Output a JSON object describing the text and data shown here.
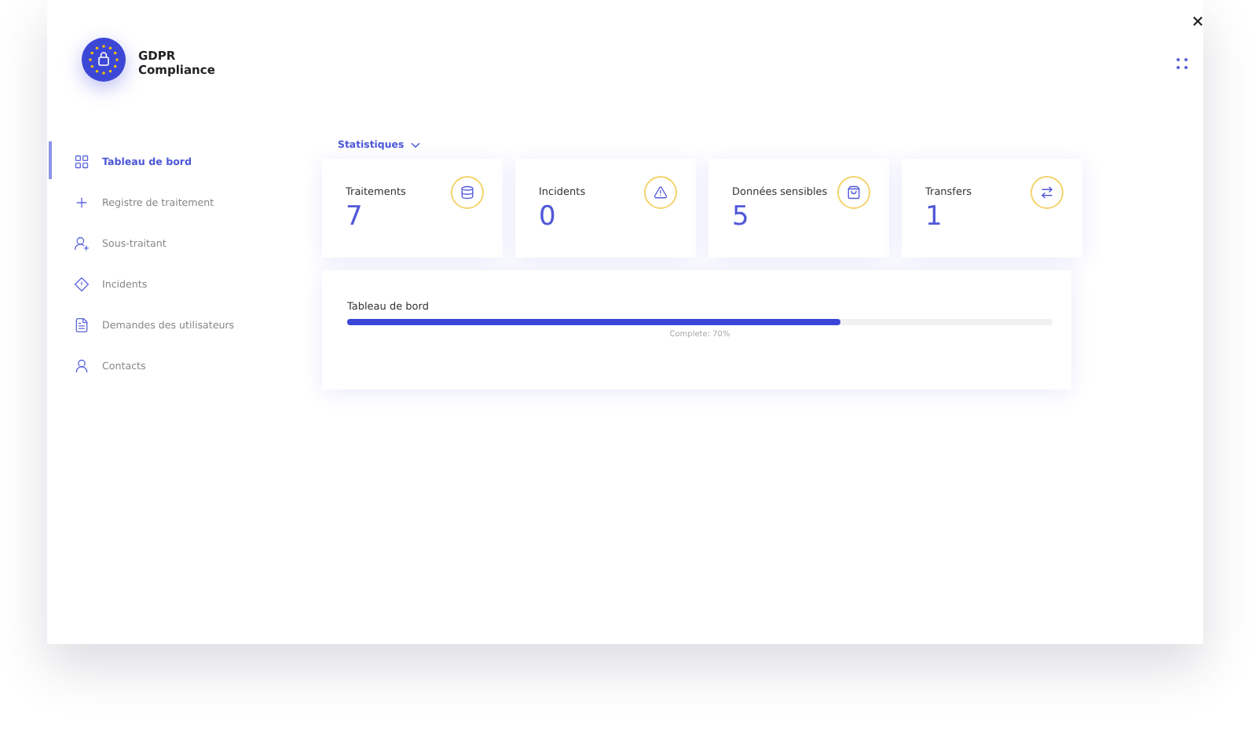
{
  "app": {
    "title": "GDPR Compliance"
  },
  "sidebar": {
    "items": [
      {
        "label": "Tableau de bord",
        "selected": true
      },
      {
        "label": "Registre de traitement",
        "selected": false
      },
      {
        "label": "Sous-traitant",
        "selected": false
      },
      {
        "label": "Incidents",
        "selected": false
      },
      {
        "label": "Demandes des utilisateurs",
        "selected": false
      },
      {
        "label": "Contacts",
        "selected": false
      }
    ]
  },
  "section": {
    "label": "Statistiques"
  },
  "stats": [
    {
      "label": "Traitements",
      "value": "7"
    },
    {
      "label": "Incidents",
      "value": "0"
    },
    {
      "label": "Données sensibles",
      "value": "5"
    },
    {
      "label": "Transfers",
      "value": "1"
    }
  ],
  "progress": {
    "title": "Tableau de bord",
    "level": 0.7,
    "reading": "Complete: 70%"
  }
}
